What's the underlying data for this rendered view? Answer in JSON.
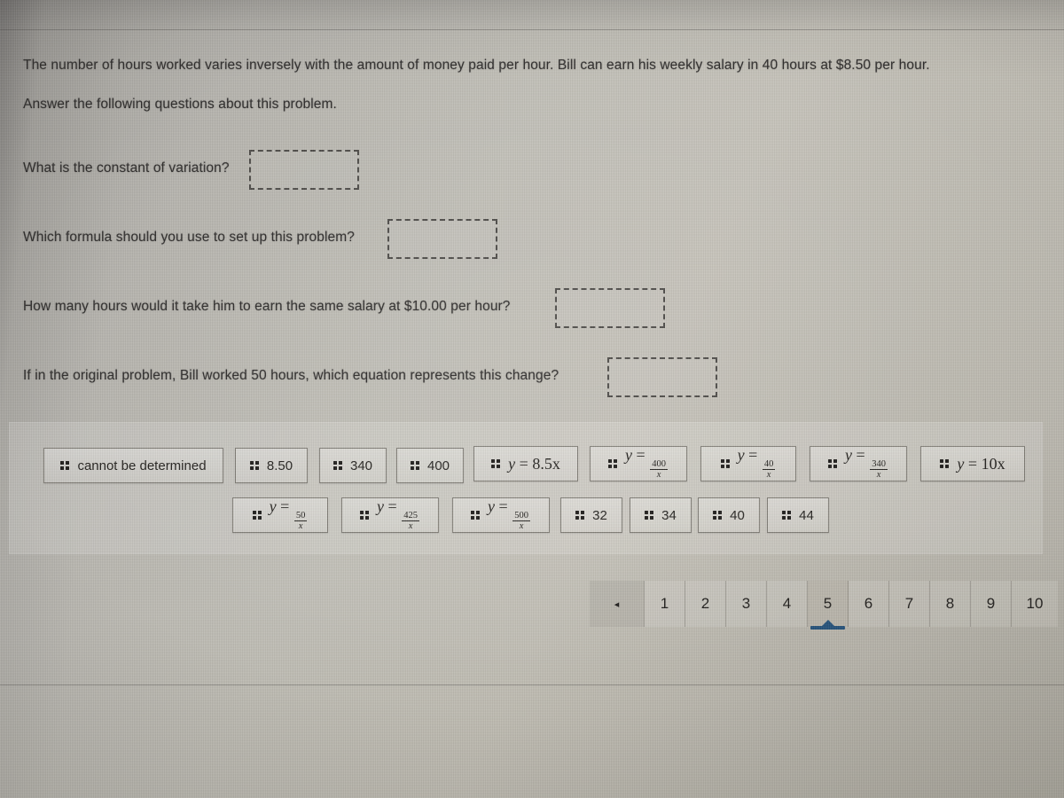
{
  "problem": {
    "statement": "The number of hours worked varies inversely with the amount of money paid per hour. Bill can earn his weekly salary in 40 hours at $8.50 per hour.",
    "instruction": "Answer the following questions about this problem."
  },
  "questions": [
    {
      "label": "What is the constant of variation?",
      "answer": ""
    },
    {
      "label": "Which formula should you use to set up this problem?",
      "answer": ""
    },
    {
      "label": "How many hours would it take him to earn the same salary at $10.00 per hour?",
      "answer": ""
    },
    {
      "label": "If in the original problem, Bill worked 50 hours, which equation represents this change?",
      "answer": ""
    }
  ],
  "answer_bank": {
    "handle_icon": "drag-handle-icon",
    "row1": [
      {
        "text": "cannot be determined",
        "type": "text"
      },
      {
        "text": "8.50",
        "type": "text"
      },
      {
        "text": "340",
        "type": "text"
      },
      {
        "text": "400",
        "type": "text"
      },
      {
        "text": "y = 8.5x",
        "type": "math",
        "lhs": "y",
        "rhs": "8.5x"
      },
      {
        "text": "y = 400/x",
        "type": "math-fraction",
        "lhs": "y",
        "numerator": "400",
        "denominator": "x"
      },
      {
        "text": "y = 40/x",
        "type": "math-fraction",
        "lhs": "y",
        "numerator": "40",
        "denominator": "x"
      },
      {
        "text": "y = 340/x",
        "type": "math-fraction",
        "lhs": "y",
        "numerator": "340",
        "denominator": "x"
      },
      {
        "text": "y = 10x",
        "type": "math",
        "lhs": "y",
        "rhs": "10x"
      }
    ],
    "row2": [
      {
        "text": "y = 50/x",
        "type": "math-fraction",
        "lhs": "y",
        "numerator": "50",
        "denominator": "x"
      },
      {
        "text": "y = 425/x",
        "type": "math-fraction",
        "lhs": "y",
        "numerator": "425",
        "denominator": "x"
      },
      {
        "text": "y = 500/x",
        "type": "math-fraction",
        "lhs": "y",
        "numerator": "500",
        "denominator": "x"
      },
      {
        "text": "32",
        "type": "text"
      },
      {
        "text": "34",
        "type": "text"
      },
      {
        "text": "40",
        "type": "text"
      },
      {
        "text": "44",
        "type": "text"
      }
    ]
  },
  "pagination": {
    "prev_label": "◂",
    "prev_icon": "triangle-left-icon",
    "pages": [
      "1",
      "2",
      "3",
      "4",
      "5",
      "6",
      "7",
      "8",
      "9",
      "10"
    ],
    "active_page": "5"
  },
  "colors": {
    "accent_blue": "#245079",
    "page_background": "#bebbb2",
    "text": "#2e2c2b",
    "chip_border": "#807d76"
  }
}
